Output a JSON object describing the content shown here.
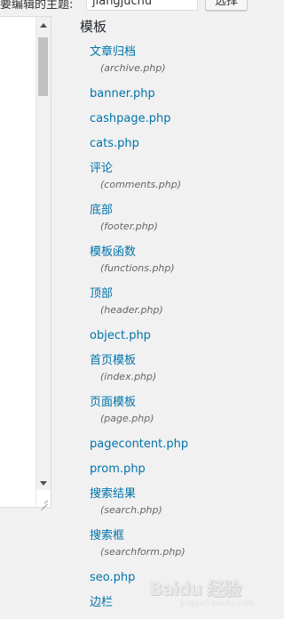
{
  "topbar": {
    "label": "要编辑的主题:",
    "theme_value": "jiangjuchu",
    "select_button": "选择"
  },
  "templates": {
    "heading": "模板",
    "items": [
      {
        "name": "文章归档",
        "file": "(archive.php)"
      },
      {
        "name": "banner.php"
      },
      {
        "name": "cashpage.php"
      },
      {
        "name": "cats.php"
      },
      {
        "name": "评论",
        "file": "(comments.php)"
      },
      {
        "name": "底部",
        "file": "(footer.php)"
      },
      {
        "name": "模板函数",
        "file": "(functions.php)"
      },
      {
        "name": "顶部",
        "file": "(header.php)"
      },
      {
        "name": "object.php"
      },
      {
        "name": "首页模板",
        "file": "(index.php)"
      },
      {
        "name": "页面模板",
        "file": "(page.php)"
      },
      {
        "name": "pagecontent.php"
      },
      {
        "name": "prom.php"
      },
      {
        "name": "搜索结果",
        "file": "(search.php)"
      },
      {
        "name": "搜索框",
        "file": "(searchform.php)"
      },
      {
        "name": "seo.php"
      },
      {
        "name": "边栏"
      }
    ]
  },
  "watermark": {
    "text": "Baidu 经验",
    "sub": "jingyan.baidu.com"
  },
  "colors": {
    "link": "#0073aa",
    "background": "#f1f1f1"
  }
}
